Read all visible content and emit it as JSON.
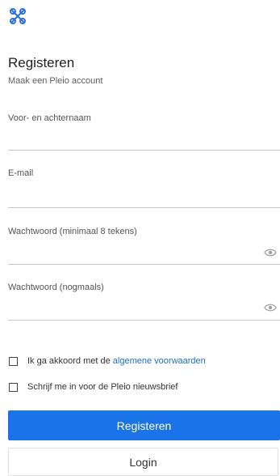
{
  "brand": {
    "logo_icon": "pleio-logo-icon",
    "accent": "#1a73e8",
    "link": "#1a6ed8"
  },
  "header": {
    "title": "Registeren",
    "subtitle": "Maak een Pleio account"
  },
  "form": {
    "name": {
      "label": "Voor- en achternaam",
      "value": ""
    },
    "email": {
      "label": "E-mail",
      "value": ""
    },
    "password": {
      "label": "Wachtwoord (minimaal 8 tekens)",
      "value": "",
      "toggle_icon": "eye-icon"
    },
    "password_repeat": {
      "label": "Wachtwoord (nogmaals)",
      "value": "",
      "toggle_icon": "eye-icon"
    }
  },
  "checkboxes": {
    "terms": {
      "prefix": "Ik ga akkoord met de",
      "link": "algemene voorwaarden",
      "checked": false
    },
    "newsletter": {
      "label": "Schrijf me in voor de Pleio nieuwsbrief",
      "checked": false
    }
  },
  "buttons": {
    "register": "Registeren",
    "login": "Login"
  }
}
